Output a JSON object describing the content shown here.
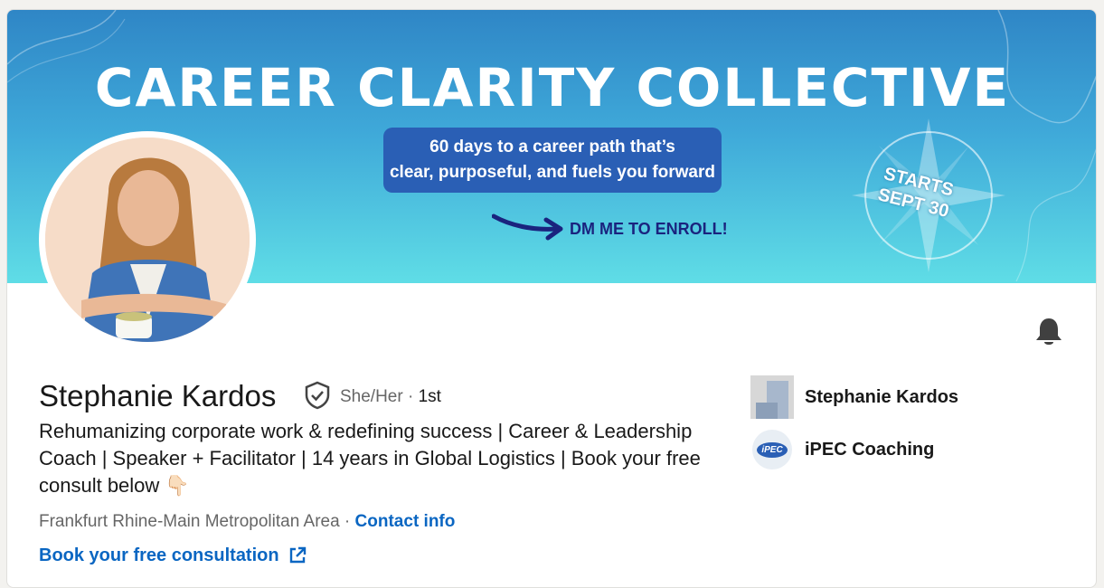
{
  "banner": {
    "title": "CAREER CLARITY COLLECTIVE",
    "promo_line1": "60 days to a career path that’s",
    "promo_line2": "clear, purposeful, and fuels you forward",
    "cta": "DM ME TO ENROLL!",
    "starts_line1": "STARTS",
    "starts_line2": "SEPT 30"
  },
  "profile": {
    "name": "Stephanie Kardos",
    "pronouns": "She/Her",
    "separator": " · ",
    "degree": "1st",
    "headline": "Rehumanizing corporate work & redefining success | Career & Leadership Coach | Speaker + Facilitator | 14 years in Global Logistics | Book your free consult below 👇🏻",
    "location": "Frankfurt Rhine-Main Metropolitan Area",
    "location_separator": " · ",
    "contact_label": "Contact info",
    "website_label": "Book your free consultation"
  },
  "right_panel": [
    {
      "label": "Stephanie Kardos",
      "icon": "company-thumb-icon"
    },
    {
      "label": "iPEC Coaching",
      "icon": "ipec-logo-icon",
      "logo_text": "iPEC"
    }
  ],
  "colors": {
    "link": "#0a66c2",
    "banner_top": "#2f86c6",
    "banner_bottom": "#5fdde6",
    "promo_box": "#2a5fb5"
  }
}
